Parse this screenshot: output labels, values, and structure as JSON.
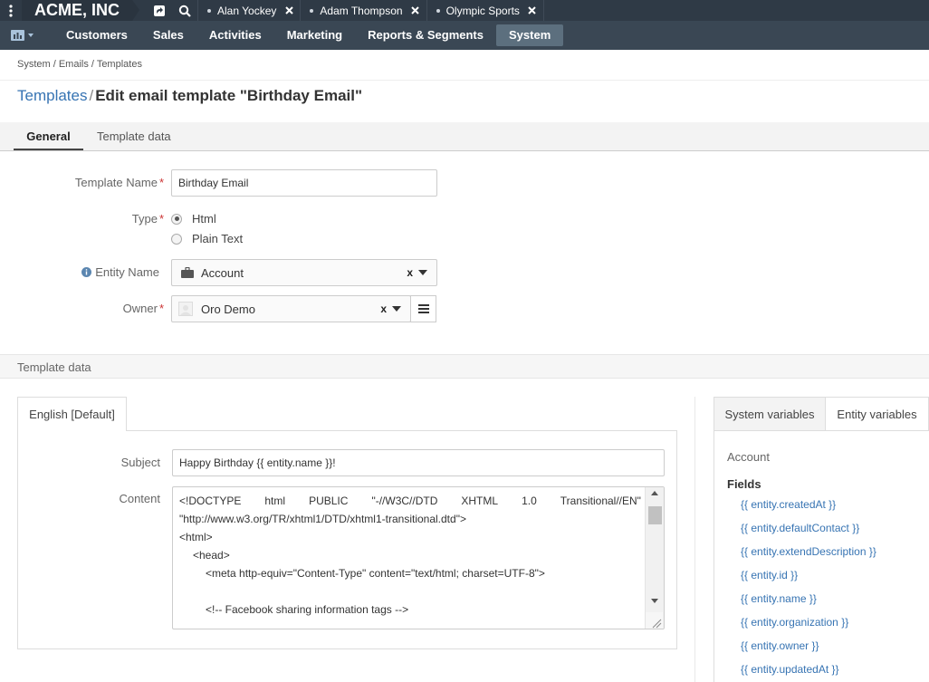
{
  "topbar": {
    "brand": "ACME, INC",
    "pinned": [
      {
        "label": "Alan Yockey"
      },
      {
        "label": "Adam Thompson"
      },
      {
        "label": "Olympic Sports"
      }
    ]
  },
  "mainnav": {
    "items": [
      "Customers",
      "Sales",
      "Activities",
      "Marketing",
      "Reports & Segments",
      "System"
    ],
    "active": "System"
  },
  "breadcrumb": "System / Emails / Templates",
  "page": {
    "title_link": "Templates",
    "title_sep": "/",
    "title": "Edit email template \"Birthday Email\""
  },
  "tabs": {
    "general": "General",
    "template_data": "Template data"
  },
  "form": {
    "template_name_label": "Template Name",
    "template_name_value": "Birthday Email",
    "type_label": "Type",
    "type_options": [
      "Html",
      "Plain Text"
    ],
    "type_selected": "Html",
    "entity_name_label": "Entity Name",
    "entity_name_value": "Account",
    "owner_label": "Owner",
    "owner_value": "Oro Demo",
    "clear_symbol": "x",
    "required_mark": "*"
  },
  "template_data": {
    "section_title": "Template data",
    "lang_tab": "English [Default]",
    "subject_label": "Subject",
    "subject_value": "Happy Birthday {{ entity.name }}!",
    "content_label": "Content",
    "content_line1_words": [
      "<!DOCTYPE",
      "html",
      "PUBLIC",
      "\"-//W3C//DTD",
      "XHTML",
      "1.0",
      "Transitional//EN\""
    ],
    "content_lines": [
      "\"http://www.w3.org/TR/xhtml1/DTD/xhtml1-transitional.dtd\">",
      "<html>",
      "<head>",
      "<meta http-equiv=\"Content-Type\" content=\"text/html; charset=UTF-8\">",
      "",
      "<!-- Facebook sharing information tags -->"
    ]
  },
  "variables": {
    "tab_system": "System variables",
    "tab_entity": "Entity variables",
    "entity": "Account",
    "fields_title": "Fields",
    "fields": [
      "{{ entity.createdAt }}",
      "{{ entity.defaultContact }}",
      "{{ entity.extendDescription }}",
      "{{ entity.id }}",
      "{{ entity.name }}",
      "{{ entity.organization }}",
      "{{ entity.owner }}",
      "{{ entity.updatedAt }}"
    ]
  }
}
